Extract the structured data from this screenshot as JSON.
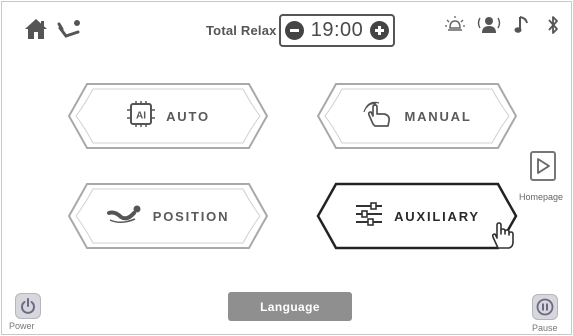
{
  "header": {
    "timer_label": "Total Relax",
    "timer_value": "19:00",
    "icons": {
      "home": "home-icon",
      "recline": "recline-icon",
      "minus": "minus-icon",
      "plus": "plus-icon",
      "light": "light-icon",
      "voice": "voice-icon",
      "music": "music-icon",
      "bluetooth": "bluetooth-icon"
    }
  },
  "modes": [
    {
      "label": "AUTO",
      "icon": "ai-chip-icon",
      "selected": false
    },
    {
      "label": "MANUAL",
      "icon": "hand-touch-icon",
      "selected": false
    },
    {
      "label": "POSITION",
      "icon": "reclined-body-icon",
      "selected": false
    },
    {
      "label": "AUXILIARY",
      "icon": "sliders-icon",
      "selected": true
    }
  ],
  "homepage": {
    "label": "Homepage",
    "icon": "play-arrow-icon"
  },
  "footer": {
    "power_label": "Power",
    "language_label": "Language",
    "pause_label": "Pause"
  },
  "colors": {
    "button_outline": "#a9a9a9",
    "selected_outline": "#222222",
    "language_bg": "#8f8f8f",
    "icon_gray": "#5a5a5a"
  }
}
